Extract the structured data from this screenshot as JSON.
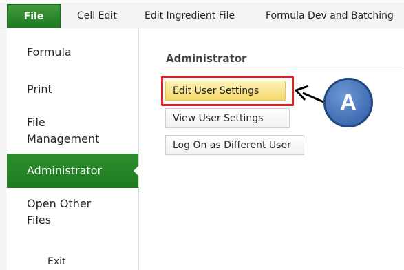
{
  "ribbon": {
    "tabs": [
      {
        "label": "File"
      },
      {
        "label": "Cell Edit"
      },
      {
        "label": "Edit Ingredient File"
      },
      {
        "label": "Formula Dev and Batching"
      }
    ]
  },
  "nav": {
    "items": [
      {
        "label": "Formula"
      },
      {
        "label": "Print"
      },
      {
        "label": "File Management"
      },
      {
        "label": "Administrator"
      },
      {
        "label": "Open Other Files"
      },
      {
        "label": "Exit"
      }
    ],
    "active_index": 3
  },
  "main": {
    "title": "Administrator",
    "buttons": [
      {
        "label": "Edit User Settings"
      },
      {
        "label": "View User Settings"
      },
      {
        "label": "Log On as Different User"
      }
    ]
  },
  "annotation": {
    "callout_label": "A",
    "box_color": "#e31e24",
    "callout_color": "#3f6db3"
  },
  "colors": {
    "accent_green": "#1f7a22"
  }
}
